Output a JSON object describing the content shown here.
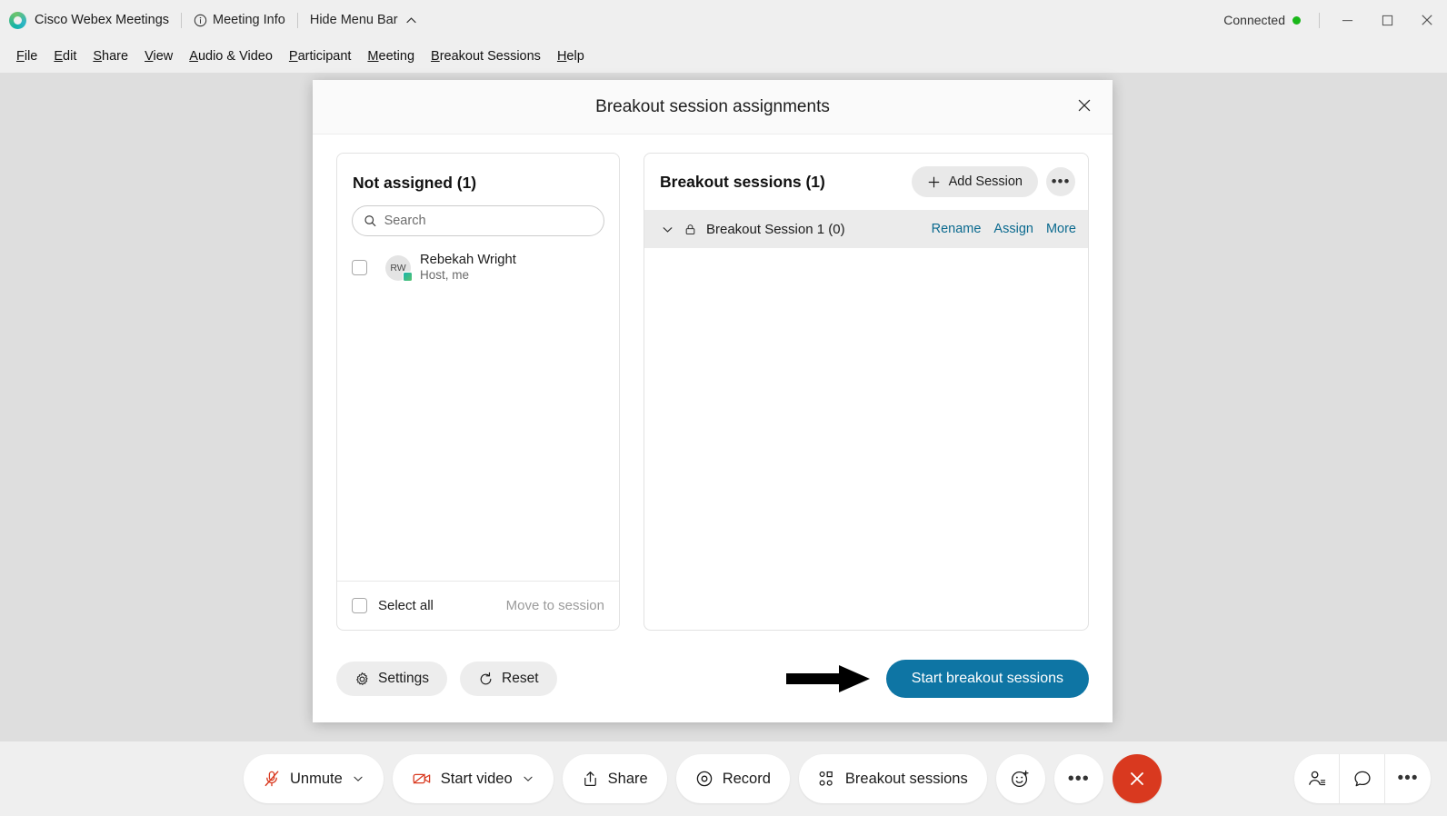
{
  "titlebar": {
    "logo_icon": "webex-logo-icon",
    "app_name": "Cisco Webex Meetings",
    "meeting_info": {
      "label": "Meeting Info",
      "icon": "info-circle-icon"
    },
    "hide_menu_bar": {
      "label": "Hide Menu Bar",
      "icon": "chevron-up-icon"
    },
    "connection": {
      "label": "Connected",
      "dot_color": "#19b719"
    },
    "window_controls": {
      "minimize": "minimize-icon",
      "maximize": "maximize-icon",
      "close": "close-icon"
    }
  },
  "menubar": {
    "items": [
      {
        "label": "File",
        "accel": "F"
      },
      {
        "label": "Edit",
        "accel": "E"
      },
      {
        "label": "Share",
        "accel": "S"
      },
      {
        "label": "View",
        "accel": "V"
      },
      {
        "label": "Audio & Video",
        "accel": "A"
      },
      {
        "label": "Participant",
        "accel": "P"
      },
      {
        "label": "Meeting",
        "accel": "M"
      },
      {
        "label": "Breakout Sessions",
        "accel": "B"
      },
      {
        "label": "Help",
        "accel": "H"
      }
    ]
  },
  "dialog": {
    "title": "Breakout session assignments",
    "close_icon": "close-icon",
    "not_assigned": {
      "title": "Not assigned (1)",
      "search_placeholder": "Search",
      "search_value": "",
      "search_icon": "search-icon",
      "people": [
        {
          "initials": "RW",
          "name": "Rebekah Wright",
          "role": "Host, me",
          "checked": false,
          "presence": "available"
        }
      ],
      "select_all_label": "Select all",
      "select_all_checked": false,
      "move_to_session_label": "Move to session"
    },
    "breakout_sessions": {
      "title": "Breakout sessions  (1)",
      "add_session_label": "Add Session",
      "add_session_icon": "plus-icon",
      "more_icon": "ellipsis-icon",
      "sessions": [
        {
          "name": "Breakout Session 1 (0)",
          "expand_icon": "chevron-down-icon",
          "lock_icon": "lock-icon",
          "actions": [
            "Rename",
            "Assign",
            "More"
          ]
        }
      ]
    },
    "footer": {
      "settings_label": "Settings",
      "settings_icon": "gear-icon",
      "reset_label": "Reset",
      "reset_icon": "refresh-icon",
      "start_label": "Start breakout sessions",
      "start_color": "#0e75a4",
      "arrow_annotation": "right-arrow-annotation"
    }
  },
  "controlbar": {
    "buttons": [
      {
        "name": "unmute",
        "label": "Unmute",
        "icon": "microphone-muted-icon",
        "has_caret": true
      },
      {
        "name": "start-video",
        "label": "Start video",
        "icon": "camera-muted-icon",
        "has_caret": true
      },
      {
        "name": "share",
        "label": "Share",
        "icon": "share-upload-icon",
        "has_caret": false
      },
      {
        "name": "record",
        "label": "Record",
        "icon": "record-circle-icon",
        "has_caret": false
      },
      {
        "name": "breakout-sessions",
        "label": "Breakout sessions",
        "icon": "breakout-grid-icon",
        "has_caret": false
      }
    ],
    "reactions_icon": "smiley-plus-icon",
    "more_icon": "ellipsis-icon",
    "end_icon": "close-x-icon",
    "right_buttons": [
      {
        "name": "participants",
        "icon": "participants-icon"
      },
      {
        "name": "chat",
        "icon": "chat-bubble-icon"
      },
      {
        "name": "more-panels",
        "icon": "ellipsis-icon"
      }
    ]
  }
}
